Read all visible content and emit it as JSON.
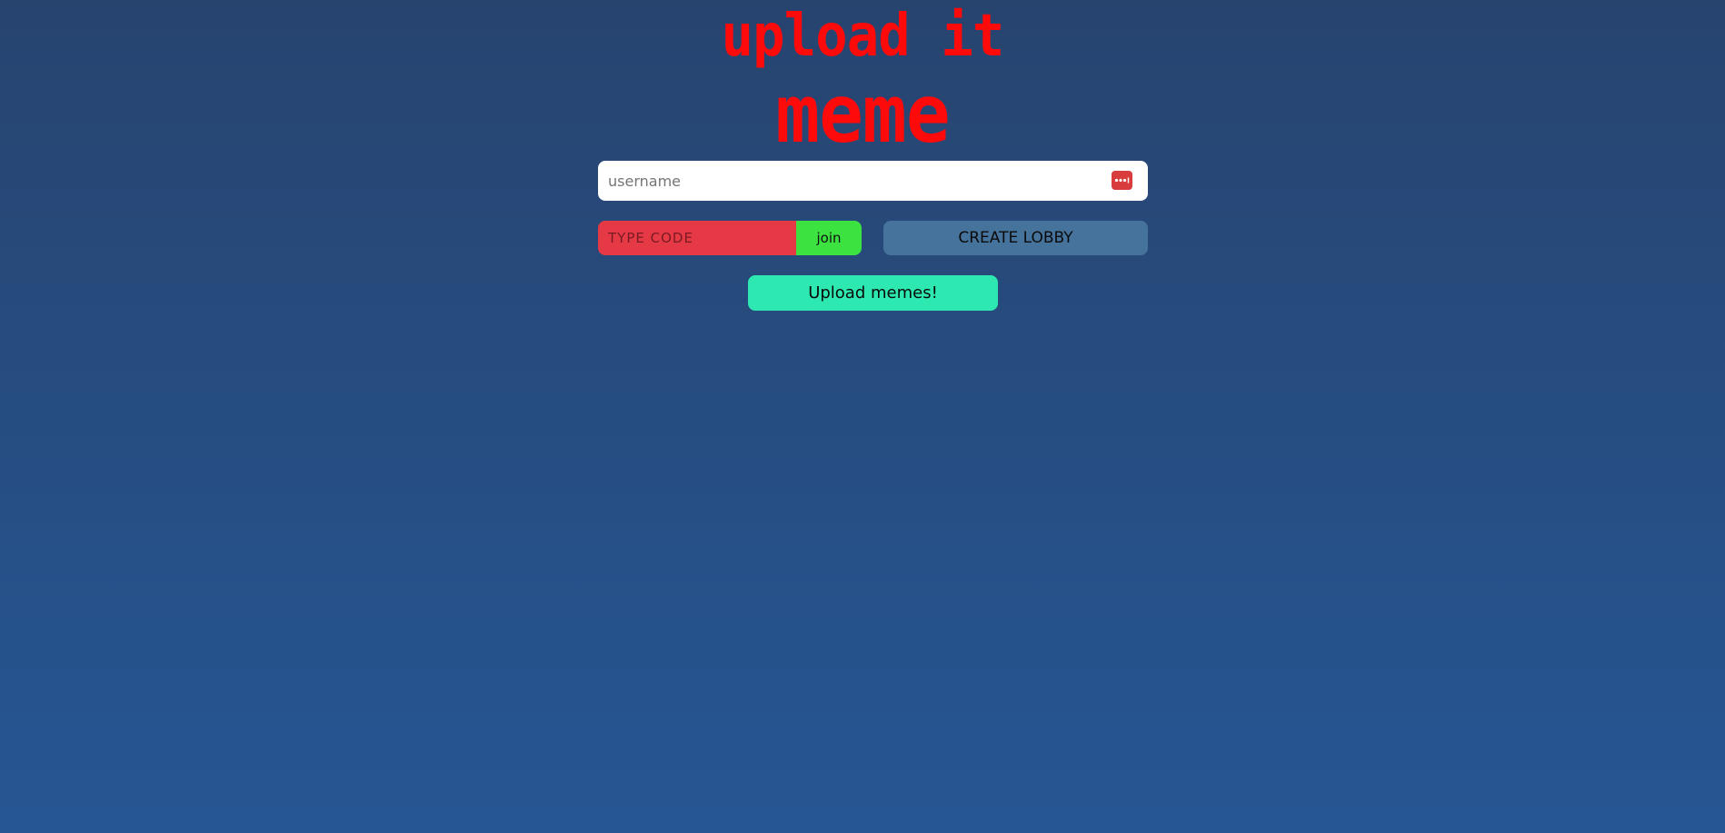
{
  "logo": {
    "line1": "upload it",
    "line2": "meme"
  },
  "username": {
    "placeholder": "username",
    "value": ""
  },
  "lobby": {
    "code_placeholder": "TYPE CODE",
    "code_value": "",
    "join_label": "join",
    "create_label": "CREATE LOBBY"
  },
  "upload": {
    "label": "Upload memes!"
  },
  "colors": {
    "logo": "#ff0a0a",
    "code_field": "#e63946",
    "join": "#3be240",
    "create": "#46739b",
    "upload": "#2de8b0"
  },
  "icons": {
    "password_manager": "password-manager-icon"
  }
}
